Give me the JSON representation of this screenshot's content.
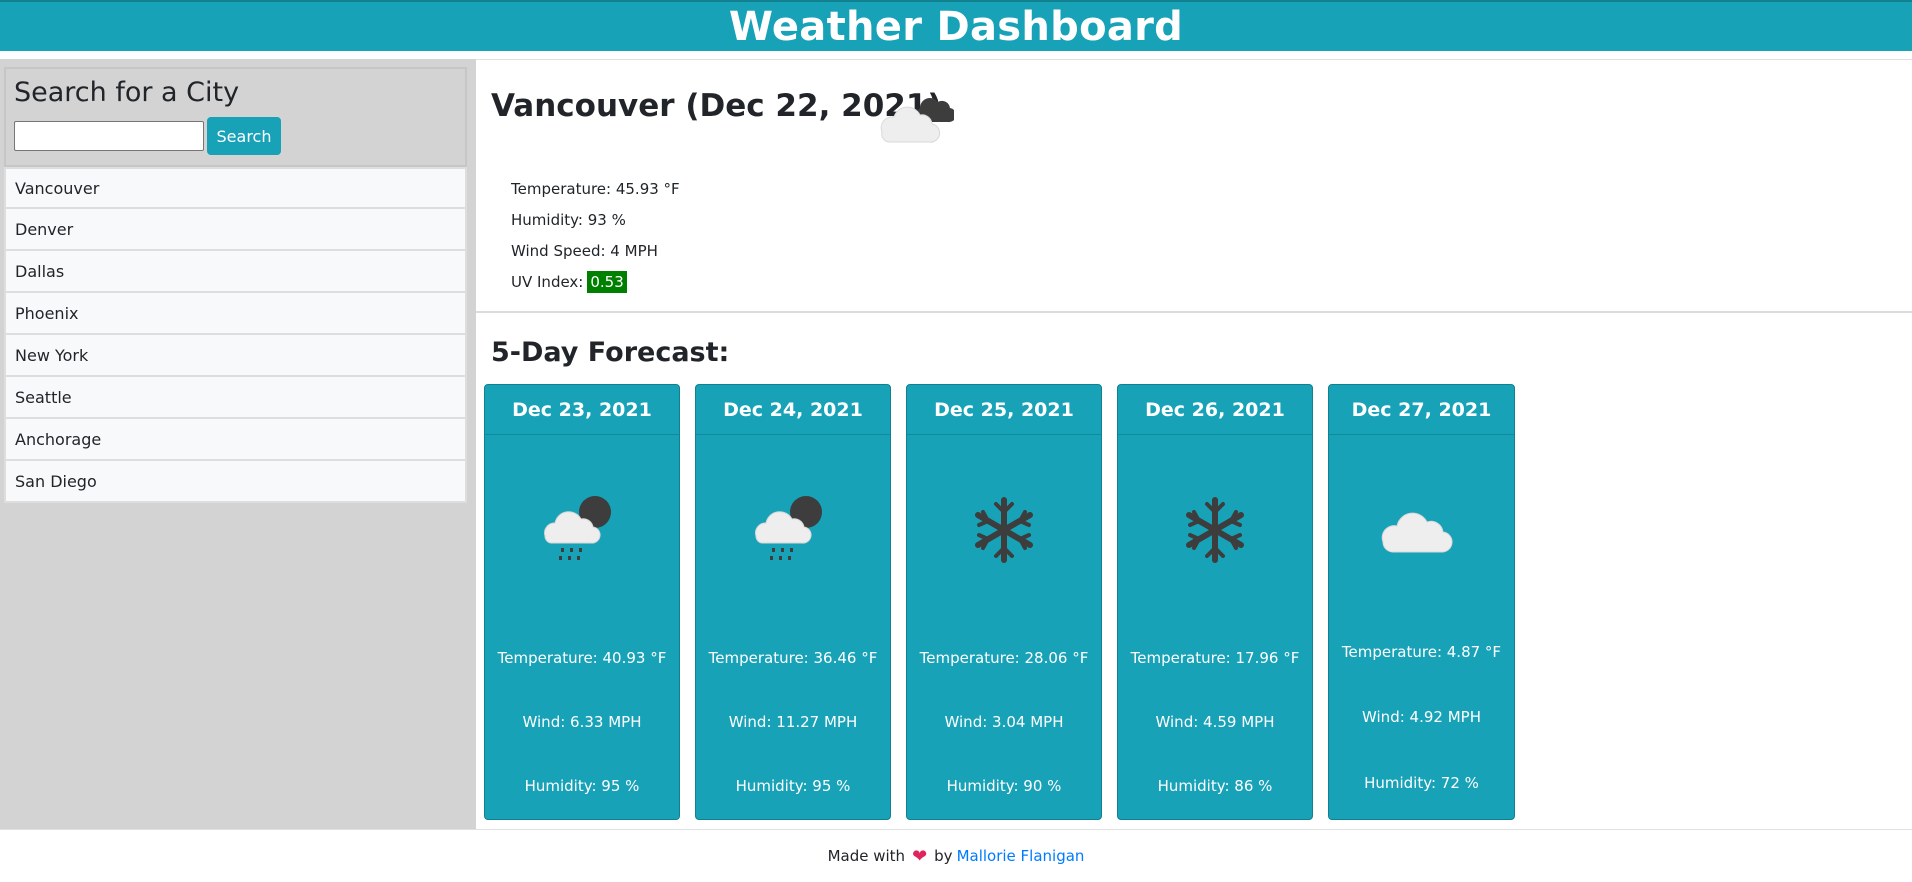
{
  "header": {
    "title": "Weather Dashboard"
  },
  "search": {
    "title": "Search for a City",
    "input_value": "",
    "button_label": "Search"
  },
  "cities": [
    "Vancouver",
    "Denver",
    "Dallas",
    "Phoenix",
    "New York",
    "Seattle",
    "Anchorage",
    "San Diego"
  ],
  "current": {
    "title": "Vancouver (Dec 22, 2021)",
    "icon": "cloudy-icon",
    "temperature": "Temperature: 45.93 °F",
    "humidity": "Humidity: 93 %",
    "wind": "Wind Speed: 4 MPH",
    "uv_label": "UV Index:",
    "uv_value": "0.53",
    "uv_color": "#008000"
  },
  "forecast": {
    "title": "5-Day Forecast:",
    "days": [
      {
        "date": "Dec 23, 2021",
        "icon": "rain-showers-icon",
        "temperature": "Temperature: 40.93 °F",
        "wind": "Wind: 6.33 MPH",
        "humidity": "Humidity: 95 %"
      },
      {
        "date": "Dec 24, 2021",
        "icon": "rain-showers-icon",
        "temperature": "Temperature: 36.46 °F",
        "wind": "Wind: 11.27 MPH",
        "humidity": "Humidity: 95 %"
      },
      {
        "date": "Dec 25, 2021",
        "icon": "snowflake-icon",
        "temperature": "Temperature: 28.06 °F",
        "wind": "Wind: 3.04 MPH",
        "humidity": "Humidity: 90 %"
      },
      {
        "date": "Dec 26, 2021",
        "icon": "snowflake-icon",
        "temperature": "Temperature: 17.96 °F",
        "wind": "Wind: 4.59 MPH",
        "humidity": "Humidity: 86 %"
      },
      {
        "date": "Dec 27, 2021",
        "icon": "cloud-icon",
        "temperature": "Temperature: 4.87 °F",
        "wind": "Wind: 4.92 MPH",
        "humidity": "Humidity: 72 %"
      }
    ]
  },
  "footer": {
    "made_with": "Made with",
    "by": "by",
    "author": "Mallorie Flanigan"
  },
  "colors": {
    "accent": "#17a2b8",
    "sidebar": "#d3d3d3",
    "link": "#007bff"
  }
}
